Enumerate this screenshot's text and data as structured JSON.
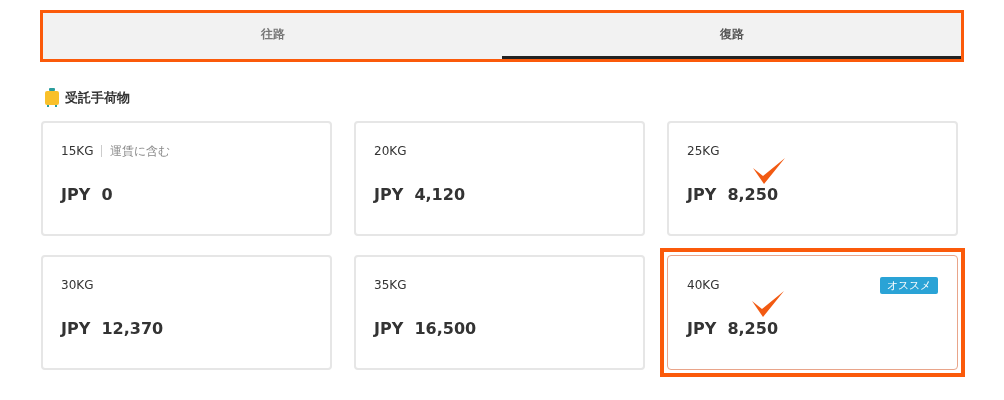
{
  "tabs": {
    "highlighted": true,
    "items": [
      {
        "label": "往路",
        "selected": false
      },
      {
        "label": "復路",
        "selected": true
      }
    ]
  },
  "section": {
    "title": "受託手荷物"
  },
  "options": [
    {
      "weight": "15KG",
      "note": "運賃に含む",
      "price": "JPY  0",
      "selected": false,
      "checkmark": false,
      "highlighted": false
    },
    {
      "weight": "20KG",
      "price": "JPY  4,120",
      "selected": false,
      "checkmark": false,
      "highlighted": false
    },
    {
      "weight": "25KG",
      "price": "JPY  8,250",
      "selected": false,
      "checkmark": true,
      "highlighted": false
    },
    {
      "weight": "30KG",
      "price": "JPY  12,370",
      "selected": false,
      "checkmark": false,
      "highlighted": false
    },
    {
      "weight": "35KG",
      "price": "JPY  16,500",
      "selected": false,
      "checkmark": false,
      "highlighted": false
    },
    {
      "weight": "40KG",
      "badge": "オススメ",
      "price": "JPY  8,250",
      "selected": true,
      "checkmark": true,
      "highlighted": true
    }
  ]
}
